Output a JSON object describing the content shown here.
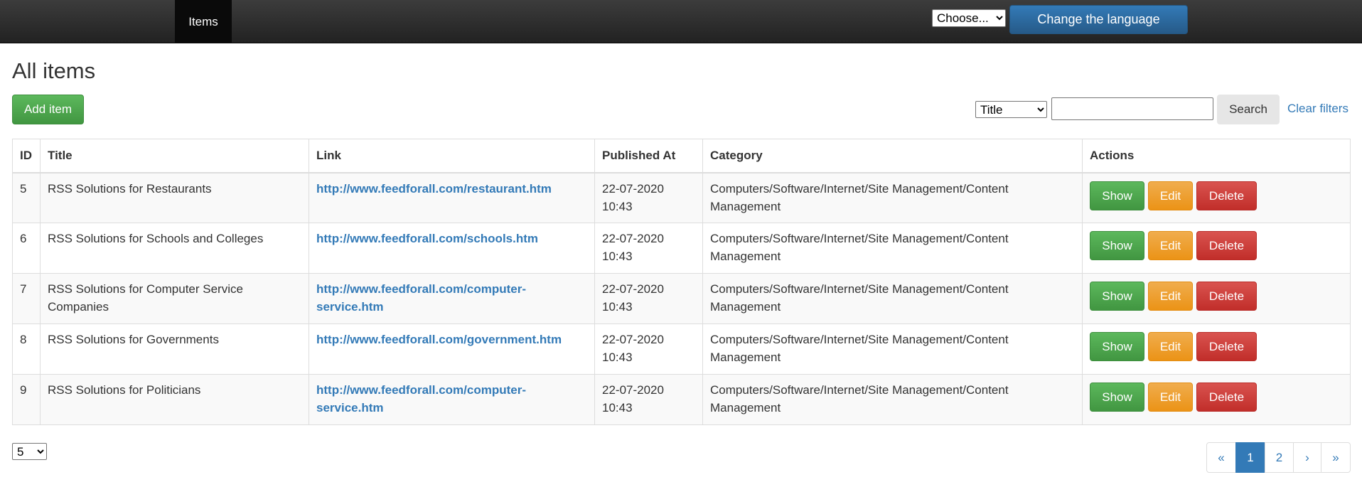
{
  "navbar": {
    "active_item": "Items",
    "language_select": {
      "selected": "Choose..."
    },
    "language_button": "Change the language"
  },
  "page": {
    "title": "All items",
    "add_button": "Add item"
  },
  "filters": {
    "field_select": {
      "selected": "Title"
    },
    "search_value": "",
    "search_button": "Search",
    "clear_link": "Clear filters"
  },
  "table": {
    "headers": [
      "ID",
      "Title",
      "Link",
      "Published At",
      "Category",
      "Actions"
    ],
    "rows": [
      {
        "id": "5",
        "title": "RSS Solutions for Restaurants",
        "link": "http://www.feedforall.com/restaurant.htm",
        "published": "22-07-2020 10:43",
        "category": "Computers/Software/Internet/Site Management/Content Management"
      },
      {
        "id": "6",
        "title": "RSS Solutions for Schools and Colleges",
        "link": "http://www.feedforall.com/schools.htm",
        "published": "22-07-2020 10:43",
        "category": "Computers/Software/Internet/Site Management/Content Management"
      },
      {
        "id": "7",
        "title": "RSS Solutions for Computer Service Companies",
        "link": "http://www.feedforall.com/computer-service.htm",
        "published": "22-07-2020 10:43",
        "category": "Computers/Software/Internet/Site Management/Content Management"
      },
      {
        "id": "8",
        "title": "RSS Solutions for Governments",
        "link": "http://www.feedforall.com/government.htm",
        "published": "22-07-2020 10:43",
        "category": "Computers/Software/Internet/Site Management/Content Management"
      },
      {
        "id": "9",
        "title": "RSS Solutions for Politicians",
        "link": "http://www.feedforall.com/computer-service.htm",
        "published": "22-07-2020 10:43",
        "category": "Computers/Software/Internet/Site Management/Content Management"
      }
    ],
    "actions": {
      "show": "Show",
      "edit": "Edit",
      "delete": "Delete"
    }
  },
  "footer": {
    "page_size": {
      "selected": "5"
    },
    "pagination": {
      "first": "«",
      "pages": [
        "1",
        "2"
      ],
      "current": "1",
      "next": "›",
      "last": "»"
    }
  },
  "colors": {
    "primary": "#337ab7",
    "success": "#5cb85c",
    "warning": "#f0ad4e",
    "danger": "#d9534f"
  }
}
